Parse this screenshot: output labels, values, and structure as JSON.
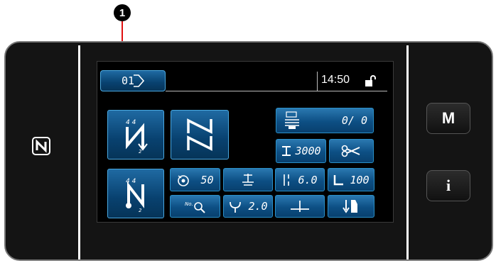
{
  "callout": {
    "number": "1"
  },
  "header": {
    "pattern_no": "01",
    "time": "14:50"
  },
  "buttons": {
    "counter_value": "0/ 0",
    "stitch_count": "3000",
    "tension": "50",
    "stitch_length": "6.0",
    "presser": "100",
    "fork": "2.0"
  },
  "side": {
    "menu_label": "M",
    "info_label": "i"
  },
  "colors": {
    "accent_blue": "#0d4f84",
    "callout_red": "#e01010",
    "panel": "#141414"
  },
  "icons": [
    "nfc-icon",
    "lock-open-icon",
    "bobbin-counter-icon",
    "thread-trimmer-icon",
    "tension-dial-icon",
    "presser-foot-icon",
    "stitch-length-icon",
    "corner-icon",
    "search-no-icon",
    "fork-icon",
    "needle-position-icon",
    "feed-icon"
  ]
}
